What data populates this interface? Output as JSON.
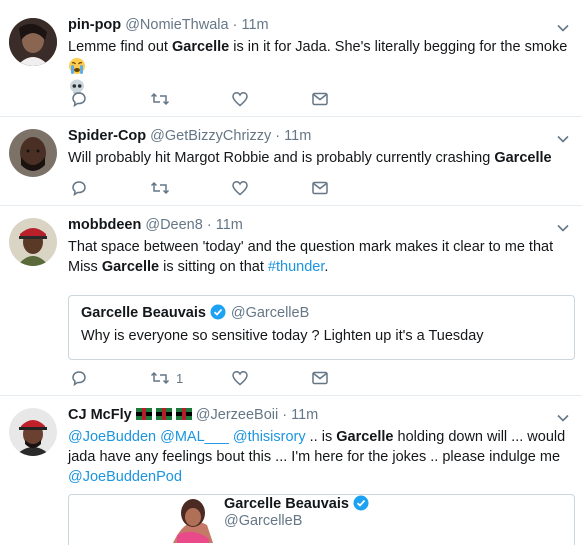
{
  "tweets": [
    {
      "name": "pin-pop",
      "handle": "@NomieThwala",
      "sep": "·",
      "time": "11m",
      "text_pre": "Lemme find out ",
      "text_bold": "Garcelle",
      "text_post": " is in it for Jada. She's literally begging for the smoke"
    },
    {
      "name": "Spider-Cop",
      "handle": "@GetBizzyChrizzy",
      "sep": "·",
      "time": "11m",
      "text_pre": "Will probably hit Margot Robbie and is probably currently crashing ",
      "text_bold": "Garcelle",
      "text_post": ""
    },
    {
      "name": "mobbdeen",
      "handle": "@Deen8",
      "sep": "·",
      "time": "11m",
      "text_pre": "That space between 'today' and the question mark makes it clear to me that Miss ",
      "text_bold": "Garcelle",
      "text_post": " is sitting on that ",
      "hashtag": "#thunder",
      "text_end": ".",
      "retweet_count": "1",
      "quote": {
        "name": "Garcelle Beauvais",
        "handle": "@GarcelleB",
        "text": "Why is everyone so sensitive today ? Lighten up it's a Tuesday"
      }
    },
    {
      "name": "CJ McFly",
      "handle": "@JerzeeBoii",
      "sep": "·",
      "time": "11m",
      "mention1": "@JoeBudden",
      "mention2": "@MAL___",
      "mention3": "@thisisrory",
      "text_pre": " .. is ",
      "text_bold": "Garcelle",
      "text_post": " holding down will ... would jada have any feelings bout this ... I'm here for the jokes .. please indulge me",
      "mention4": "@JoeBuddenPod",
      "quote": {
        "name": "Garcelle Beauvais",
        "handle": "@GarcelleB"
      }
    }
  ],
  "colors": {
    "link": "#1b95e0",
    "muted": "#657786",
    "verified": "#1da1f2",
    "divider": "#e6ecf0"
  }
}
